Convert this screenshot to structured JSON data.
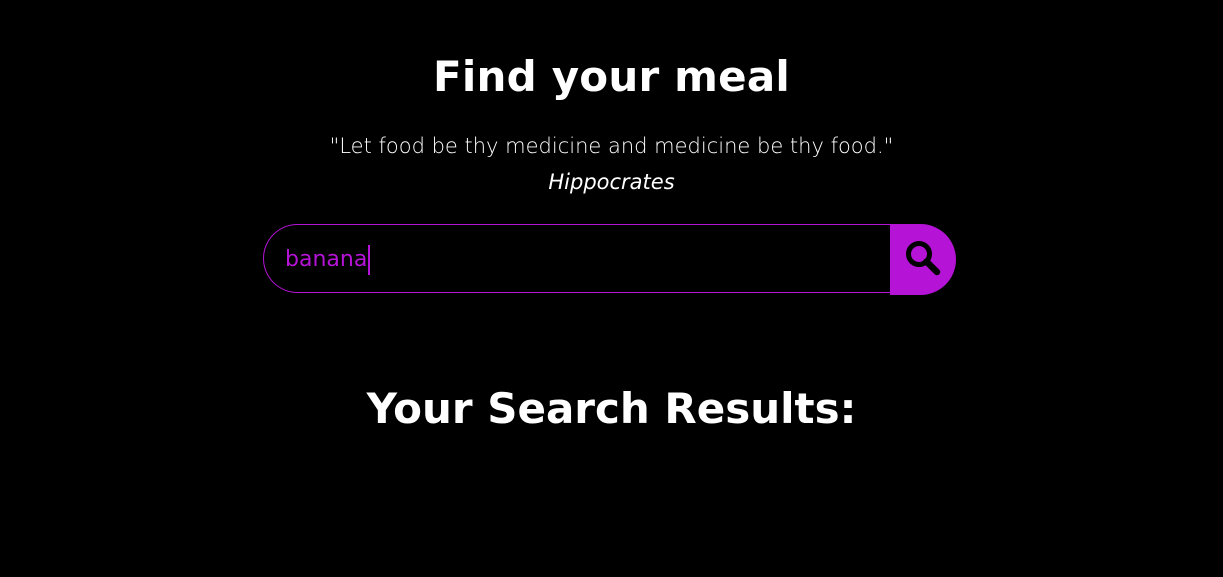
{
  "header": {
    "title": "Find your meal",
    "quote": "\"Let food be thy medicine and medicine be thy food.\"",
    "author": "Hippocrates"
  },
  "search": {
    "value": "banana",
    "icon": "search-icon",
    "accent_color": "#b514d6"
  },
  "results": {
    "title": "Your Search Results:"
  }
}
